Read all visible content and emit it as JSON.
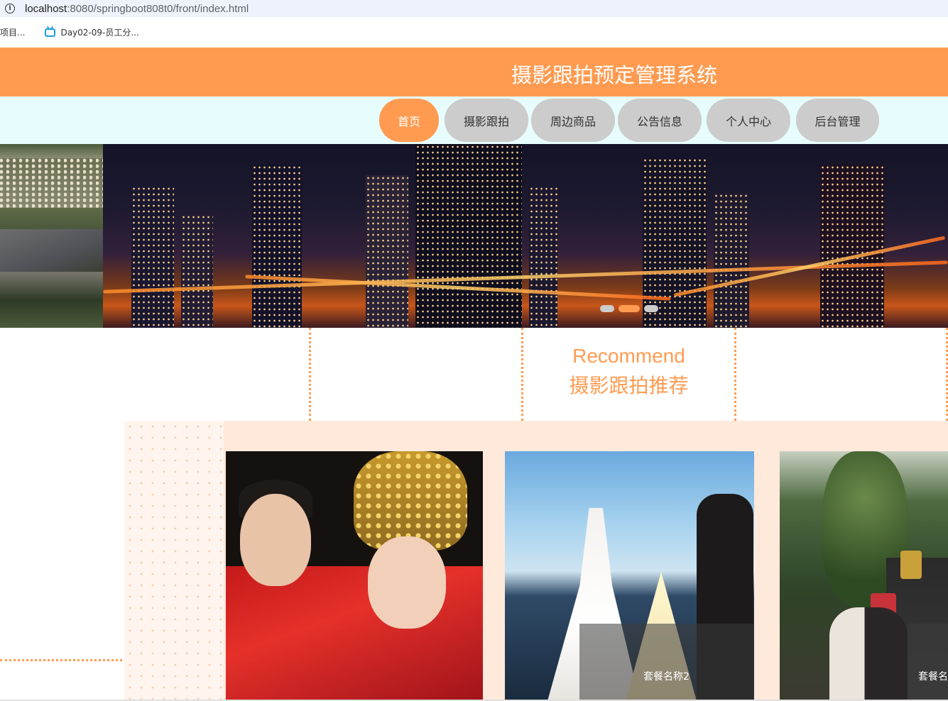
{
  "browser": {
    "url_host": "localhost",
    "url_path": ":8080/springboot808t0/front/index.html",
    "bookmarks": [
      {
        "label": "项目..."
      },
      {
        "label": "Day02-09-员工分..."
      }
    ]
  },
  "site": {
    "title": "摄影跟拍预定管理系统",
    "nav": [
      {
        "label": "首页",
        "active": true
      },
      {
        "label": "摄影跟拍",
        "active": false
      },
      {
        "label": "周边商品",
        "active": false
      },
      {
        "label": "公告信息",
        "active": false
      },
      {
        "label": "个人中心",
        "active": false
      },
      {
        "label": "后台管理",
        "active": false
      }
    ],
    "banner": {
      "slides": 3,
      "active_slide": 2
    },
    "recommend": {
      "title_en": "Recommend",
      "title_cn": "摄影跟拍推荐",
      "cards": [
        {
          "label": ""
        },
        {
          "label": "套餐名称2"
        },
        {
          "label": "套餐名"
        }
      ]
    }
  },
  "colors": {
    "accent": "#ff9b51",
    "nav_bg": "#e7fcfd",
    "nav_inactive": "#cccccc",
    "panel_bg": "#ffe9db"
  }
}
